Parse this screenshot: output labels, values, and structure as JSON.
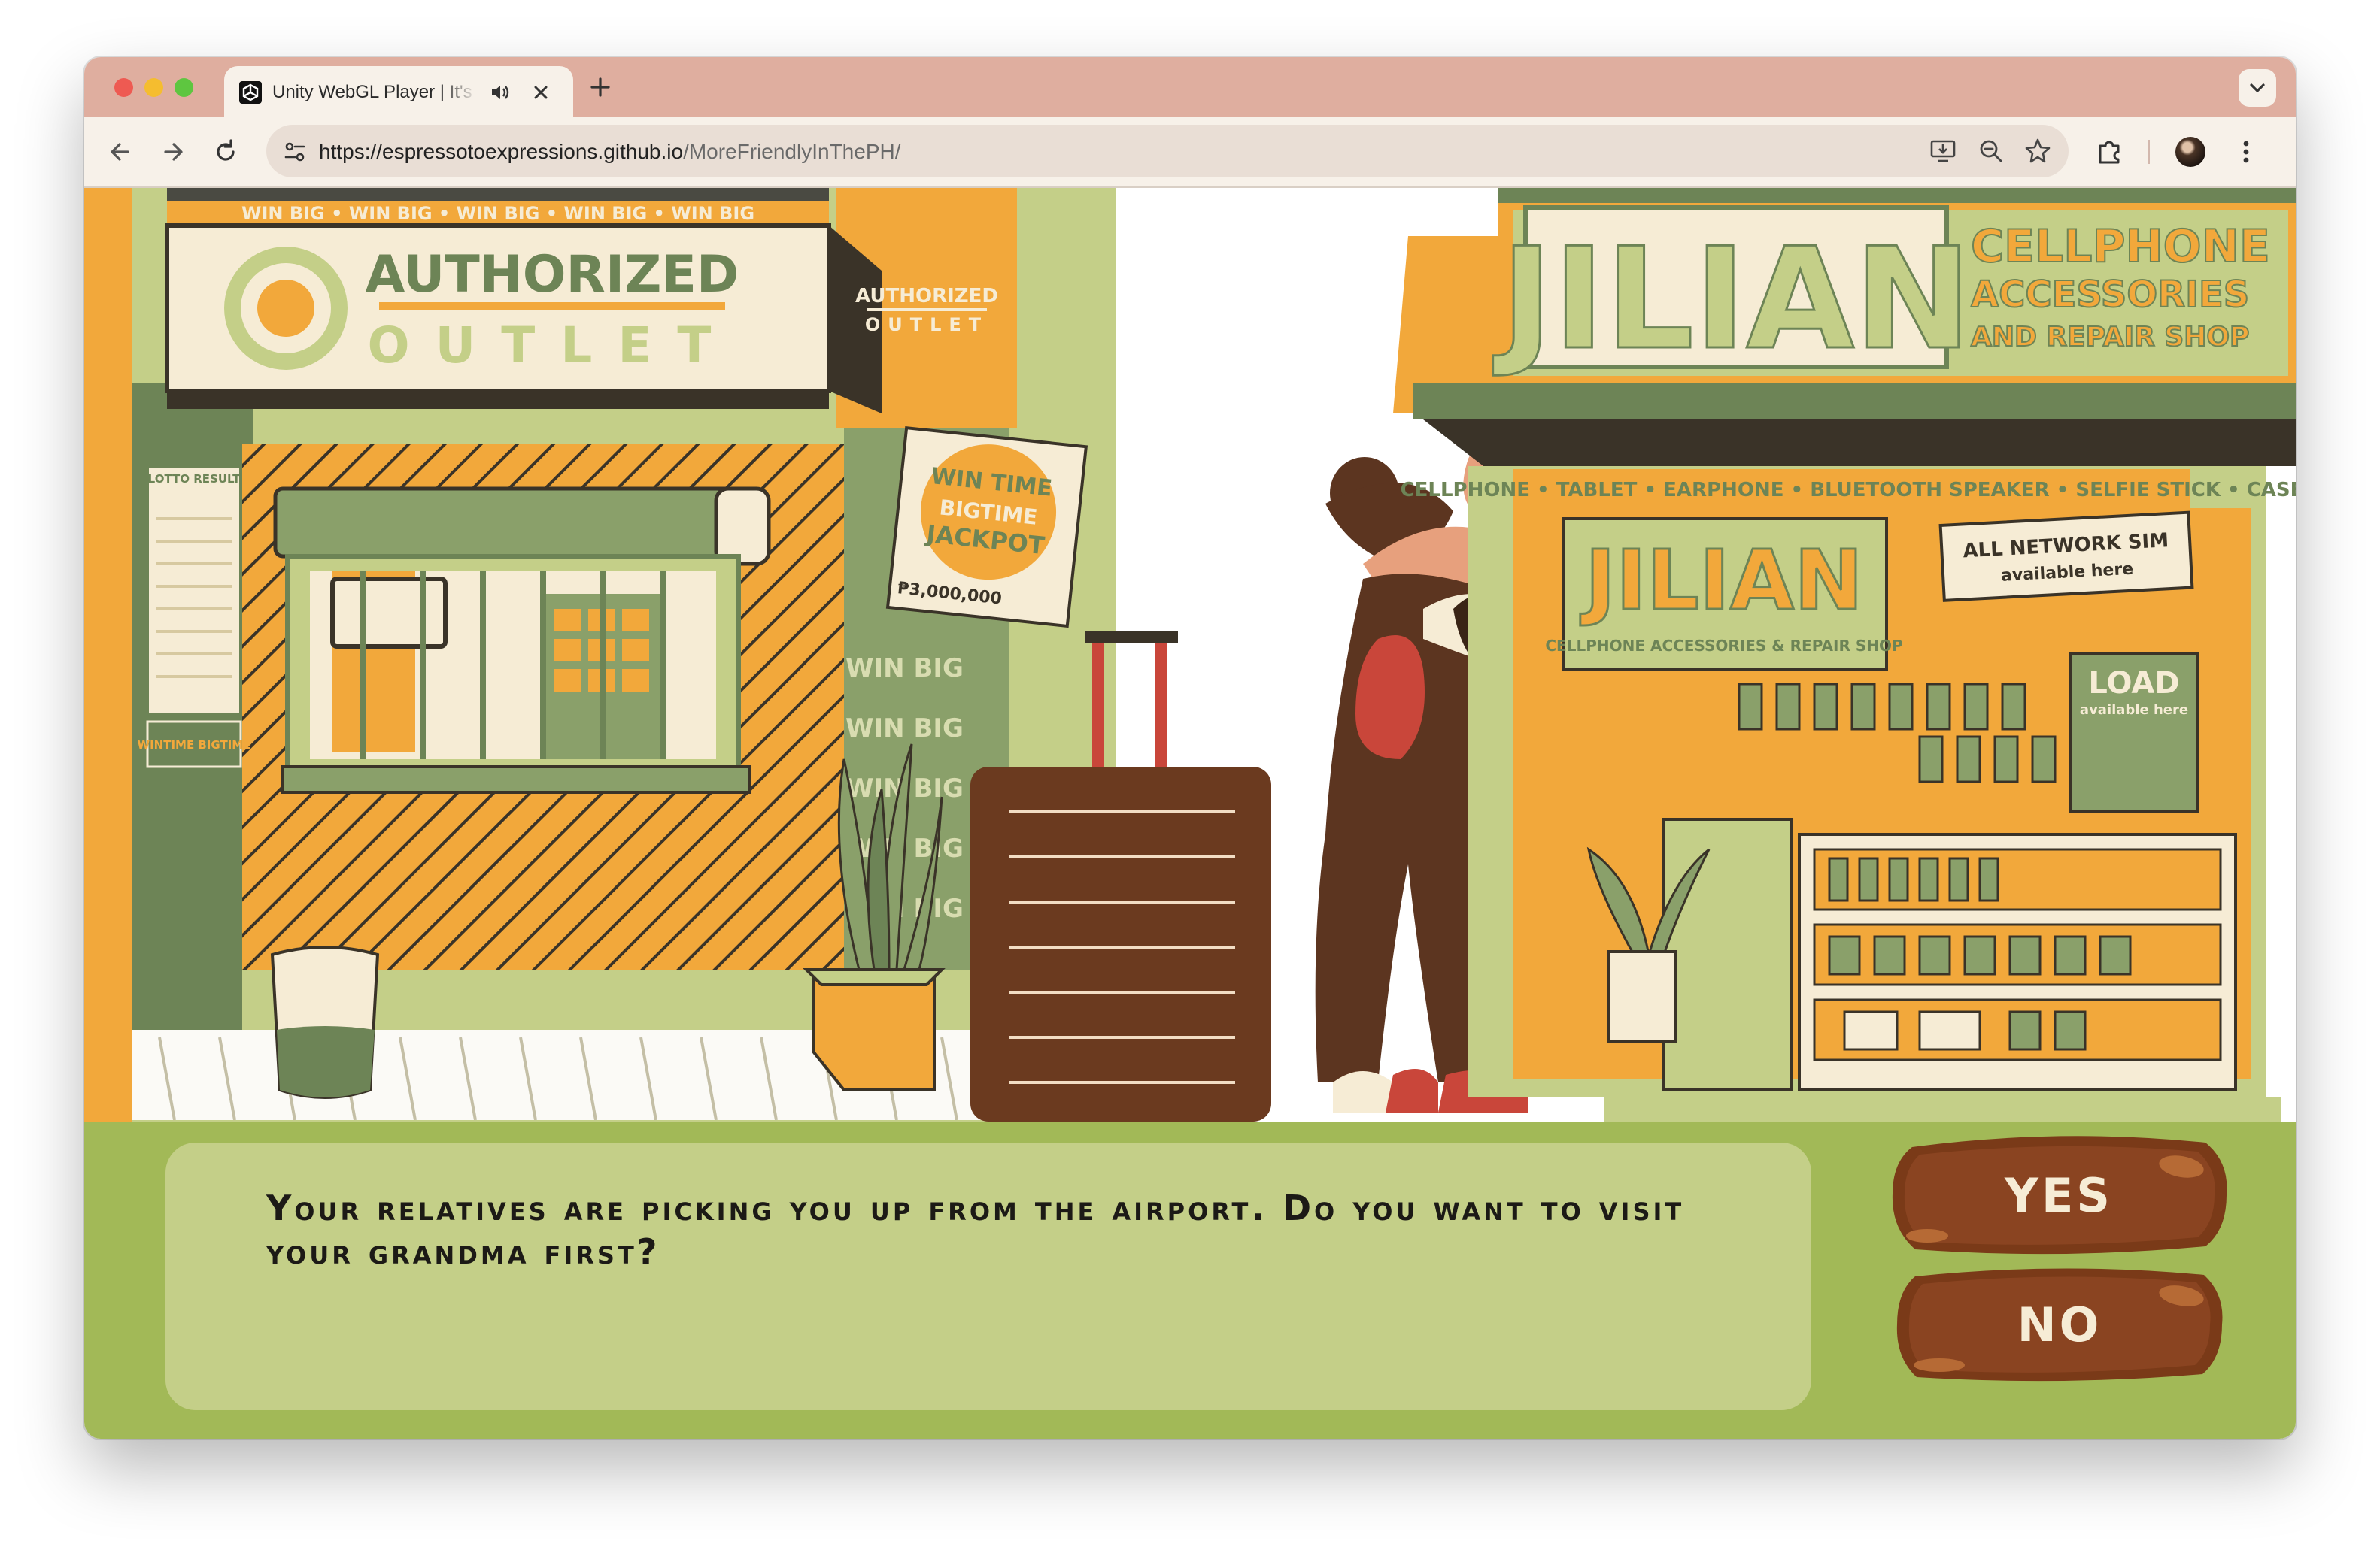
{
  "browser": {
    "tab": {
      "title": "Unity WebGL Player | It's More Friendly in the PH"
    },
    "url": {
      "host": "https://espressotoexpressions.github.io",
      "path": "/MoreFriendlyInThePH/"
    }
  },
  "scene": {
    "left_shop": {
      "banner": "WIN BIG  •  WIN BIG  •  WIN BIG  •  WIN BIG  •  WIN BIG",
      "sign_line1": "AUTHORIZED",
      "sign_line2": "OUTLET",
      "side_sign_line1": "AUTHORIZED",
      "side_sign_line2": "OUTLET",
      "lotto_board_title": "LOTTO RESULT",
      "wintime_label": "WINTIME BIGTIME",
      "poster_line1": "WIN TIME",
      "poster_line2": "BIGTIME",
      "poster_line3": "JACKPOT",
      "poster_amount": "₱3,000,000",
      "wall_text": "WIN BIG"
    },
    "right_shop": {
      "name": "JILIAN",
      "sign_line1": "CELLPHONE",
      "sign_line2": "ACCESSORIES",
      "sign_line3": "AND REPAIR SHOP",
      "products_strip": "CELLPHONE • TABLET • EARPHONE • BLUETOOTH SPEAKER • SELFIE STICK • CASE",
      "inner_name": "JILIAN",
      "inner_sub": "CELLPHONE ACCESSORIES & REPAIR SHOP",
      "sim_sign_line1": "ALL NETWORK SIM",
      "sim_sign_line2": "available here",
      "load_sign_line1": "LOAD",
      "load_sign_line2": "available here"
    }
  },
  "dialogue": {
    "text": "Your relatives are picking you up from the airport. Do you want to visit your grandma first?"
  },
  "choices": {
    "yes": "YES",
    "no": "NO"
  },
  "colors": {
    "cream": "#f4ecd6",
    "orange": "#f2a83b",
    "sage": "#8aa06a",
    "light_green": "#c4cf88",
    "panel_green": "#a2b957",
    "brown": "#7a3a18",
    "dark_brown": "#5c3520"
  }
}
